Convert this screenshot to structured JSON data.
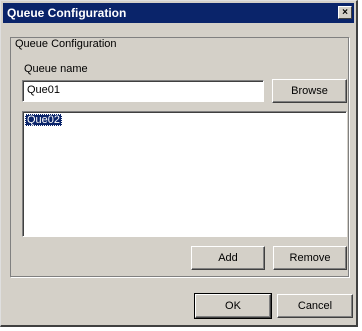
{
  "window": {
    "title": "Queue Configuration",
    "close_glyph": "×"
  },
  "group": {
    "legend": "Queue Configuration"
  },
  "queue_name": {
    "label": "Queue name",
    "value": "Que01"
  },
  "buttons": {
    "browse": "Browse",
    "add": "Add",
    "remove": "Remove",
    "ok": "OK",
    "cancel": "Cancel"
  },
  "queue_list": {
    "items": [
      "Que02"
    ],
    "selected": "Que02"
  }
}
